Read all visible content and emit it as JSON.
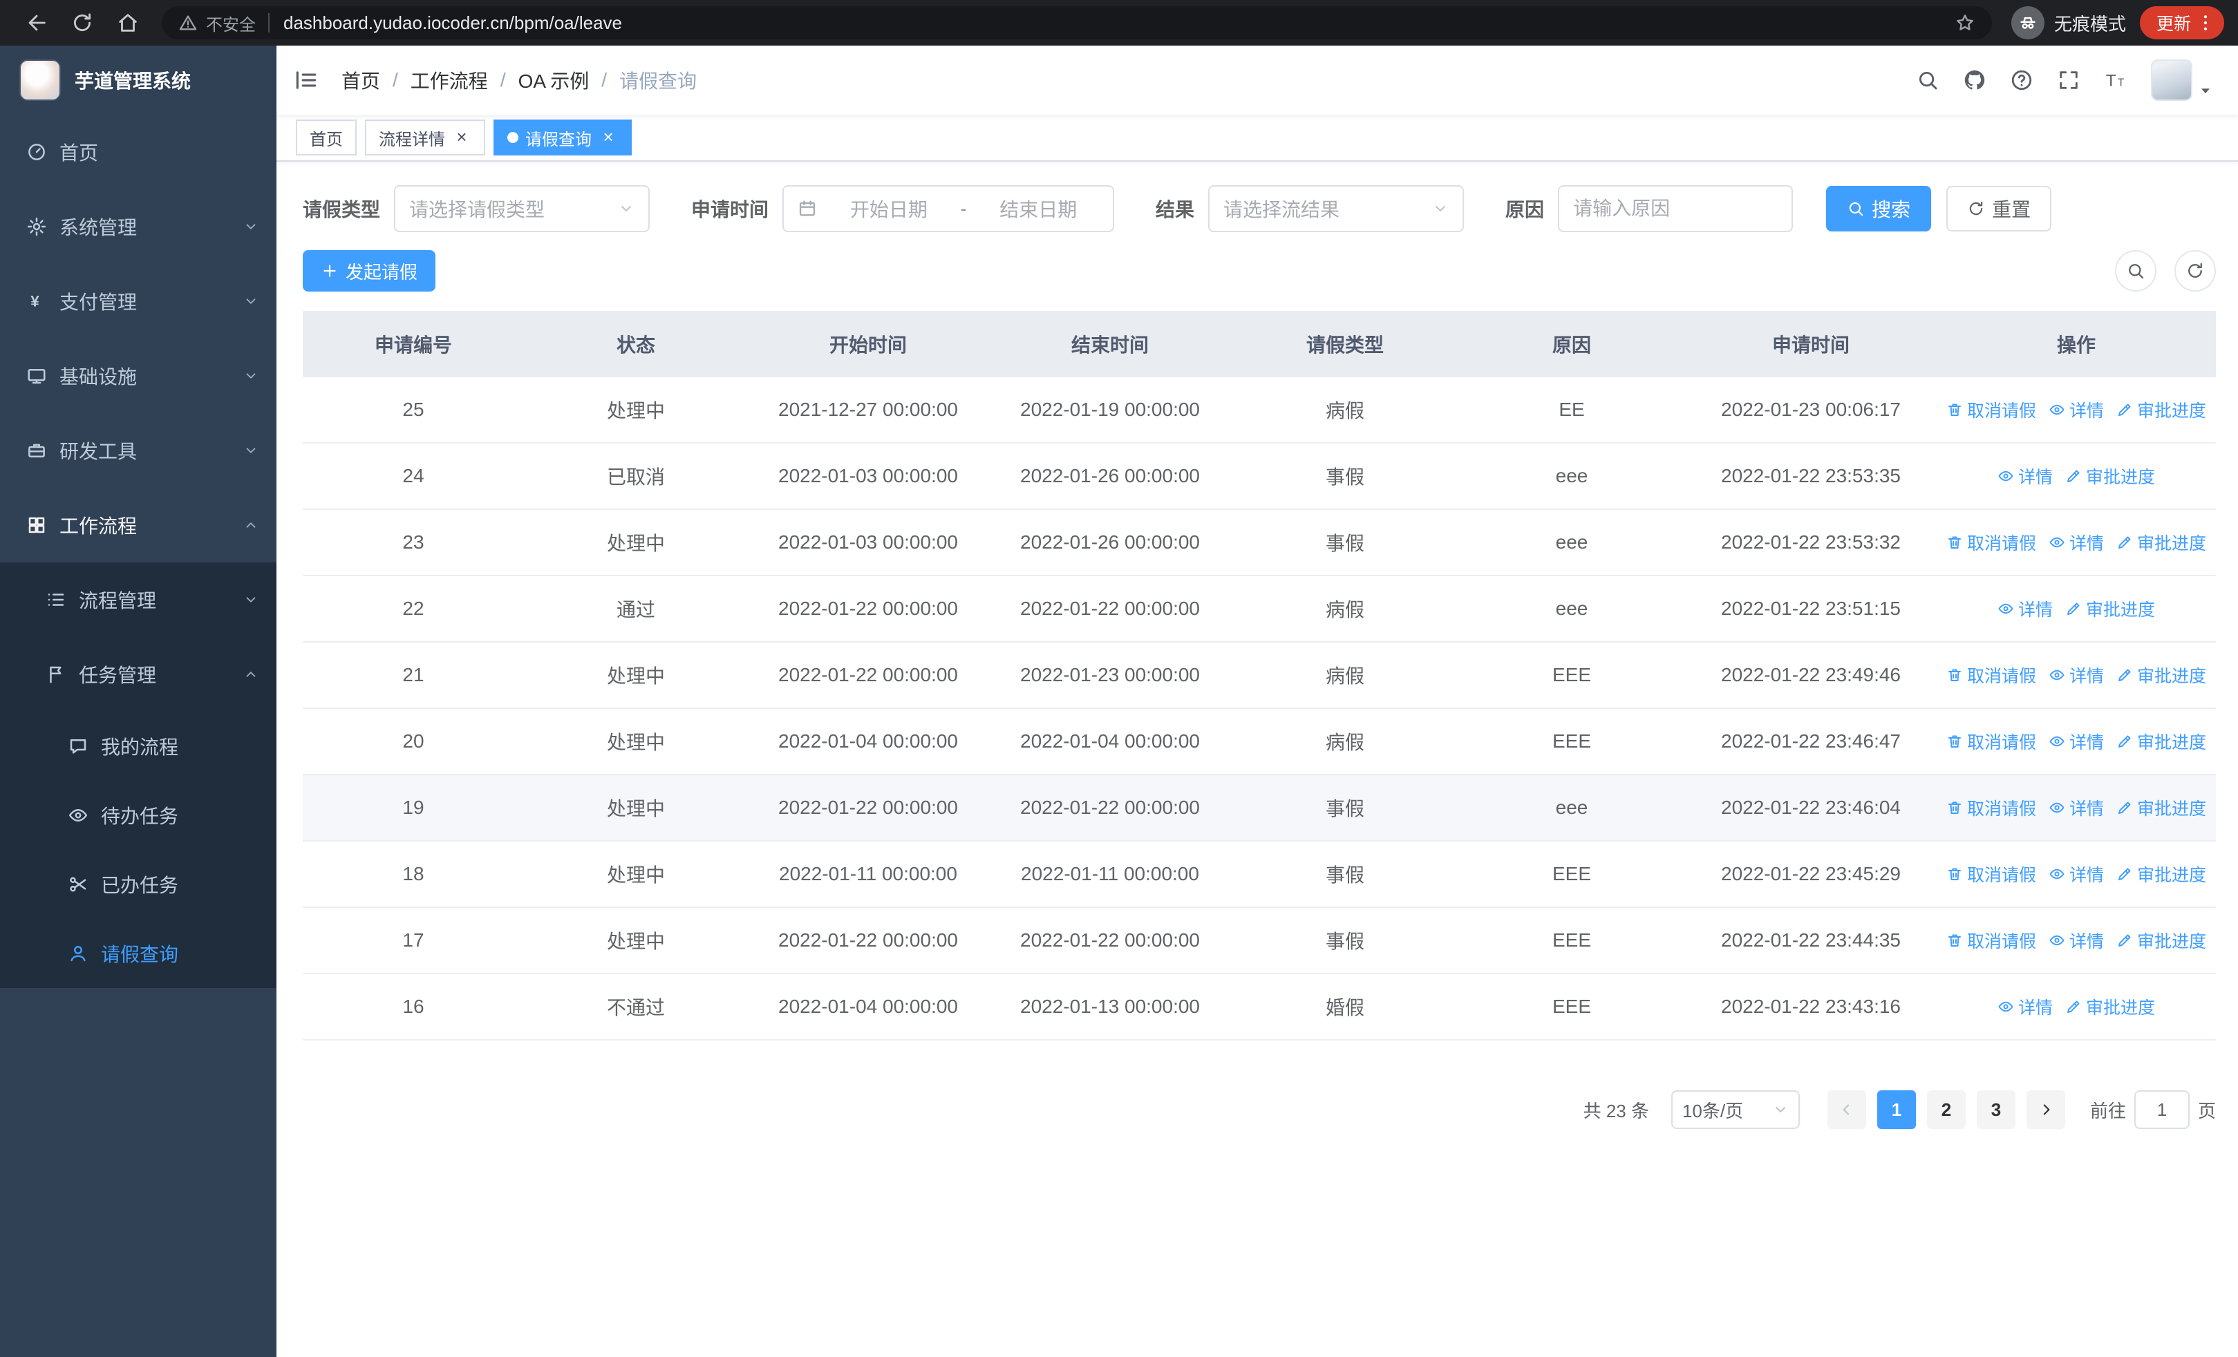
{
  "browser": {
    "security_label": "不安全",
    "url": "dashboard.yudao.iocoder.cn/bpm/oa/leave",
    "incognito_label": "无痕模式",
    "update_label": "更新"
  },
  "sidebar": {
    "title": "芋道管理系统",
    "menu": [
      {
        "key": "home",
        "label": "首页",
        "icon": "dashboard",
        "level": 1
      },
      {
        "key": "system-management",
        "label": "系统管理",
        "icon": "gear",
        "level": 1,
        "arrow": true
      },
      {
        "key": "payment-management",
        "label": "支付管理",
        "icon": "yen",
        "level": 1,
        "arrow": true
      },
      {
        "key": "infrastructure",
        "label": "基础设施",
        "icon": "monitor",
        "level": 1,
        "arrow": true
      },
      {
        "key": "dev-tools",
        "label": "研发工具",
        "icon": "toolbox",
        "level": 1,
        "arrow": true
      },
      {
        "key": "workflow",
        "label": "工作流程",
        "icon": "grid",
        "level": 1,
        "arrow": true,
        "open": true
      },
      {
        "key": "process-management",
        "label": "流程管理",
        "icon": "list",
        "level": 2,
        "arrow": true
      },
      {
        "key": "task-management",
        "label": "任务管理",
        "icon": "flag",
        "level": 2,
        "arrow": true,
        "open": true
      },
      {
        "key": "my-process",
        "label": "我的流程",
        "icon": "message",
        "level": 3
      },
      {
        "key": "todo-tasks",
        "label": "待办任务",
        "icon": "eye",
        "level": 3
      },
      {
        "key": "done-tasks",
        "label": "已办任务",
        "icon": "scissors",
        "level": 3
      },
      {
        "key": "leave-query",
        "label": "请假查询",
        "icon": "user",
        "level": 3,
        "active": true
      }
    ]
  },
  "header": {
    "breadcrumb": [
      "首页",
      "工作流程",
      "OA 示例",
      "请假查询"
    ]
  },
  "tabs": [
    {
      "key": "home",
      "label": "首页",
      "closable": false,
      "active": false
    },
    {
      "key": "process-detail",
      "label": "流程详情",
      "closable": true,
      "active": false
    },
    {
      "key": "leave-query",
      "label": "请假查询",
      "closable": true,
      "active": true
    }
  ],
  "filters": {
    "leave_type": {
      "label": "请假类型",
      "placeholder": "请选择请假类型"
    },
    "apply_time": {
      "label": "申请时间",
      "start_placeholder": "开始日期",
      "separator": "-",
      "end_placeholder": "结束日期"
    },
    "result": {
      "label": "结果",
      "placeholder": "请选择流结果"
    },
    "reason": {
      "label": "原因",
      "placeholder": "请输入原因"
    },
    "search_label": "搜索",
    "reset_label": "重置"
  },
  "toolbar": {
    "create_label": "发起请假"
  },
  "table": {
    "columns": [
      "申请编号",
      "状态",
      "开始时间",
      "结束时间",
      "请假类型",
      "原因",
      "申请时间",
      "操作"
    ],
    "action_labels": {
      "cancel": "取消请假",
      "detail": "详情",
      "progress": "审批进度"
    },
    "rows": [
      {
        "id": "25",
        "status": "处理中",
        "start": "2021-12-27 00:00:00",
        "end": "2022-01-19 00:00:00",
        "type": "病假",
        "reason": "EE",
        "apply": "2022-01-23 00:06:17",
        "cancellable": true
      },
      {
        "id": "24",
        "status": "已取消",
        "start": "2022-01-03 00:00:00",
        "end": "2022-01-26 00:00:00",
        "type": "事假",
        "reason": "eee",
        "apply": "2022-01-22 23:53:35",
        "cancellable": false
      },
      {
        "id": "23",
        "status": "处理中",
        "start": "2022-01-03 00:00:00",
        "end": "2022-01-26 00:00:00",
        "type": "事假",
        "reason": "eee",
        "apply": "2022-01-22 23:53:32",
        "cancellable": true
      },
      {
        "id": "22",
        "status": "通过",
        "start": "2022-01-22 00:00:00",
        "end": "2022-01-22 00:00:00",
        "type": "病假",
        "reason": "eee",
        "apply": "2022-01-22 23:51:15",
        "cancellable": false
      },
      {
        "id": "21",
        "status": "处理中",
        "start": "2022-01-22 00:00:00",
        "end": "2022-01-23 00:00:00",
        "type": "病假",
        "reason": "EEE",
        "apply": "2022-01-22 23:49:46",
        "cancellable": true
      },
      {
        "id": "20",
        "status": "处理中",
        "start": "2022-01-04 00:00:00",
        "end": "2022-01-04 00:00:00",
        "type": "病假",
        "reason": "EEE",
        "apply": "2022-01-22 23:46:47",
        "cancellable": true
      },
      {
        "id": "19",
        "status": "处理中",
        "start": "2022-01-22 00:00:00",
        "end": "2022-01-22 00:00:00",
        "type": "事假",
        "reason": "eee",
        "apply": "2022-01-22 23:46:04",
        "cancellable": true,
        "highlighted": true
      },
      {
        "id": "18",
        "status": "处理中",
        "start": "2022-01-11 00:00:00",
        "end": "2022-01-11 00:00:00",
        "type": "事假",
        "reason": "EEE",
        "apply": "2022-01-22 23:45:29",
        "cancellable": true
      },
      {
        "id": "17",
        "status": "处理中",
        "start": "2022-01-22 00:00:00",
        "end": "2022-01-22 00:00:00",
        "type": "事假",
        "reason": "EEE",
        "apply": "2022-01-22 23:44:35",
        "cancellable": true
      },
      {
        "id": "16",
        "status": "不通过",
        "start": "2022-01-04 00:00:00",
        "end": "2022-01-13 00:00:00",
        "type": "婚假",
        "reason": "EEE",
        "apply": "2022-01-22 23:43:16",
        "cancellable": false
      }
    ]
  },
  "pagination": {
    "total_label": "共 23 条",
    "page_size": "10条/页",
    "pages": [
      "1",
      "2",
      "3"
    ],
    "active_page": "1",
    "goto_label": "前往",
    "goto_value": "1",
    "goto_suffix": "页"
  },
  "colors": {
    "primary": "#409EFF",
    "sidebar_bg": "#304156",
    "sidebar_sub_bg": "#1f2d3d",
    "sidebar_sub2_bg": "#1f2d3d",
    "update_chip": "#d93b2b",
    "table_header_bg": "#e9ecf0",
    "row_hover_bg": "#f5f7fa"
  }
}
